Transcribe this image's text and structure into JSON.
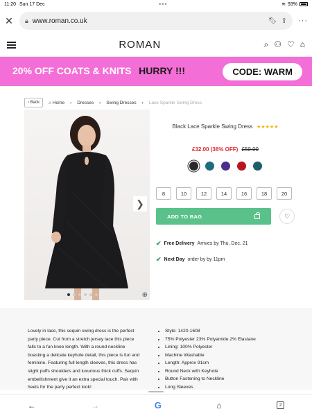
{
  "status_bar": {
    "time": "11:20",
    "date": "Sun 17 Dec",
    "dots": "•••",
    "battery": "93%"
  },
  "browser": {
    "url": "www.roman.co.uk",
    "close_icon": "close-icon",
    "more": "···"
  },
  "site": {
    "logo": "ROMAN"
  },
  "promo": {
    "offer": "20% OFF COATS & KNITS",
    "hurry": "HURRY !!!",
    "code": "CODE: WARM",
    "background": "#f46ed7"
  },
  "breadcrumb": {
    "back": "‹ Back",
    "home": "Home",
    "sep1": "›",
    "dresses": "Dresses",
    "sep2": "›",
    "swing": "Swing Dresses",
    "sep3": "›",
    "current": "Lace Sparkle Swing Dress"
  },
  "product": {
    "title": "Black Lace Sparkle Swing Dress",
    "stars": "★★★★★",
    "price_now": "£32.00 (36% OFF)",
    "price_was": "£50.00",
    "swatches": [
      "#2a2a2a",
      "#1d6e7c",
      "#4b2f8c",
      "#b8151f",
      "#1e5e6a"
    ],
    "sizes": [
      "8",
      "10",
      "12",
      "14",
      "16",
      "18",
      "20"
    ],
    "add_to_bag": "ADD TO BAG",
    "accent": "#5bc18a",
    "image_dots": 6
  },
  "delivery": [
    {
      "bold": "Free Delivery",
      "rest": "Arrives by Thu, Dec. 21"
    },
    {
      "bold": "Next Day",
      "rest": "order by by 11pm"
    }
  ],
  "description": {
    "text": "Lovely in lace, this sequin swing dress is the perfect party piece. Cut from a stretch jersey lace this piece falls to a fun knee length. With a round neckline boasting a delicate keyhole detail, this piece is fun and feminine. Featuring full length sleeves, this dress has slight puffs shoulders and luxurious thick cuffs. Sequin embellishment give it an extra special touch. Pair with heels for the party perfect look!",
    "features": [
      "Style: 1420-1608",
      "75% Polyester 23% Polyamide 2% Elastane",
      "Lining: 100% Polyester",
      "Machine Washable",
      "Length: Approx 91cm",
      "Round Neck with Keyhole",
      "Button Fastening to Neckline",
      "Long Sleeves"
    ]
  },
  "bottom_nav": {
    "back": "←",
    "forward": "→",
    "google": "G",
    "home": "⌂",
    "tabs": "2"
  }
}
